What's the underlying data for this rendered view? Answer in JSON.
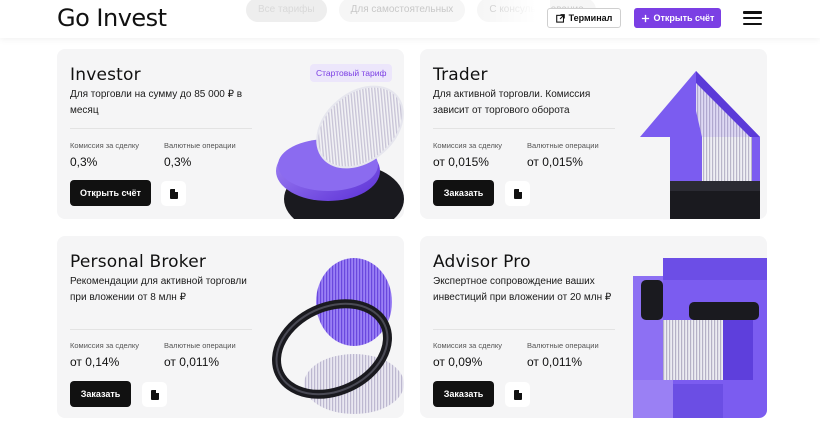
{
  "header": {
    "logo": "Go Invest",
    "tabs": [
      {
        "label": "Все тарифы"
      },
      {
        "label": "Для самостоятельных"
      },
      {
        "label": "С консультирование"
      }
    ],
    "terminal_label": "Терминал",
    "open_account_label": "Открыть счёт"
  },
  "cards": [
    {
      "title": "Investor",
      "badge": "Стартовый тариф",
      "desc": "Для торговли на сумму до 85 000 ₽ в месяц",
      "stats": [
        {
          "label": "Комиссия за сделку",
          "value": "0,3%"
        },
        {
          "label": "Валютные операции",
          "value": "0,3%"
        }
      ],
      "cta": "Открыть счёт"
    },
    {
      "title": "Trader",
      "desc": "Для активной торговли. Комиссия зависит от торгового оборота",
      "stats": [
        {
          "label": "Комиссия за сделку",
          "value": "от 0,015%"
        },
        {
          "label": "Валютные операции",
          "value": "от 0,015%"
        }
      ],
      "cta": "Заказать"
    },
    {
      "title": "Personal Broker",
      "desc": "Рекомендации для активной торговли при вложении от 8 млн ₽",
      "stats": [
        {
          "label": "Комиссия за сделку",
          "value": "от 0,14%"
        },
        {
          "label": "Валютные операции",
          "value": "от 0,011%"
        }
      ],
      "cta": "Заказать"
    },
    {
      "title": "Advisor Pro",
      "desc": "Экспертное сопровождение ваших инвестиций при вложении от 20 млн ₽",
      "stats": [
        {
          "label": "Комиссия за сделку",
          "value": "от 0,09%"
        },
        {
          "label": "Валютные операции",
          "value": "от 0,011%"
        }
      ],
      "cta": "Заказать"
    }
  ],
  "icons": {
    "terminal": "external-link-icon",
    "open_account": "plus-icon",
    "menu": "burger-menu-icon",
    "document": "pdf-document-icon"
  },
  "colors": {
    "accent": "#7b3fe4",
    "card_bg": "#f5f5f6",
    "cta_bg": "#111111"
  }
}
